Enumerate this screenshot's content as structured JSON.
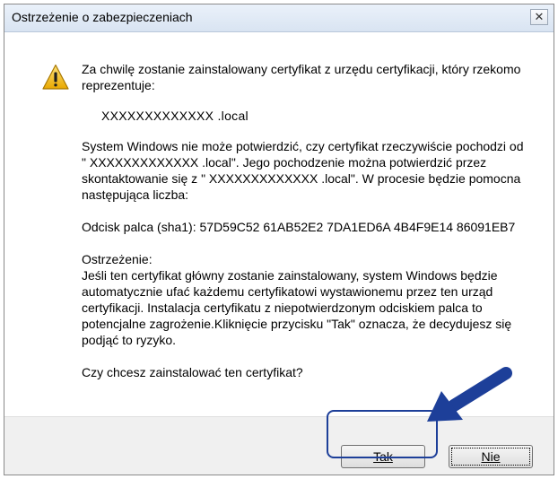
{
  "window": {
    "title": "Ostrzeżenie o zabezpieczeniach",
    "close_glyph": "✕"
  },
  "message": {
    "intro": "Za chwilę zostanie zainstalowany certyfikat z urzędu certyfikacji, który rzekomo reprezentuje:",
    "host": "XXXXXXXXXXXXX .local",
    "verify": "System Windows nie może potwierdzić, czy certyfikat rzeczywiście pochodzi od \" XXXXXXXXXXXXX .local\". Jego pochodzenie można potwierdzić przez skontaktowanie się z \" XXXXXXXXXXXXX .local\". W procesie będzie pomocna następująca liczba:",
    "thumbprint": "Odcisk palca (sha1): 57D59C52 61AB52E2 7DA1ED6A 4B4F9E14 86091EB7",
    "warning_heading": "Ostrzeżenie:",
    "warning_body": "Jeśli ten certyfikat główny zostanie zainstalowany, system Windows będzie automatycznie ufać każdemu certyfikatowi wystawionemu przez ten urząd certyfikacji. Instalacja certyfikatu z niepotwierdzonym odciskiem palca to potencjalne zagrożenie.Kliknięcie przycisku \"Tak\" oznacza, że decydujesz się podjąć to ryzyko.",
    "question": "Czy chcesz zainstalować ten certyfikat?"
  },
  "buttons": {
    "yes": "Tak",
    "no": "Nie"
  },
  "icons": {
    "warning": "warning-icon",
    "arrow": "arrow-pointer-icon"
  },
  "colors": {
    "arrow": "#1d3f99",
    "highlight": "#1d3f99",
    "warning_fill": "#f4c61e"
  }
}
